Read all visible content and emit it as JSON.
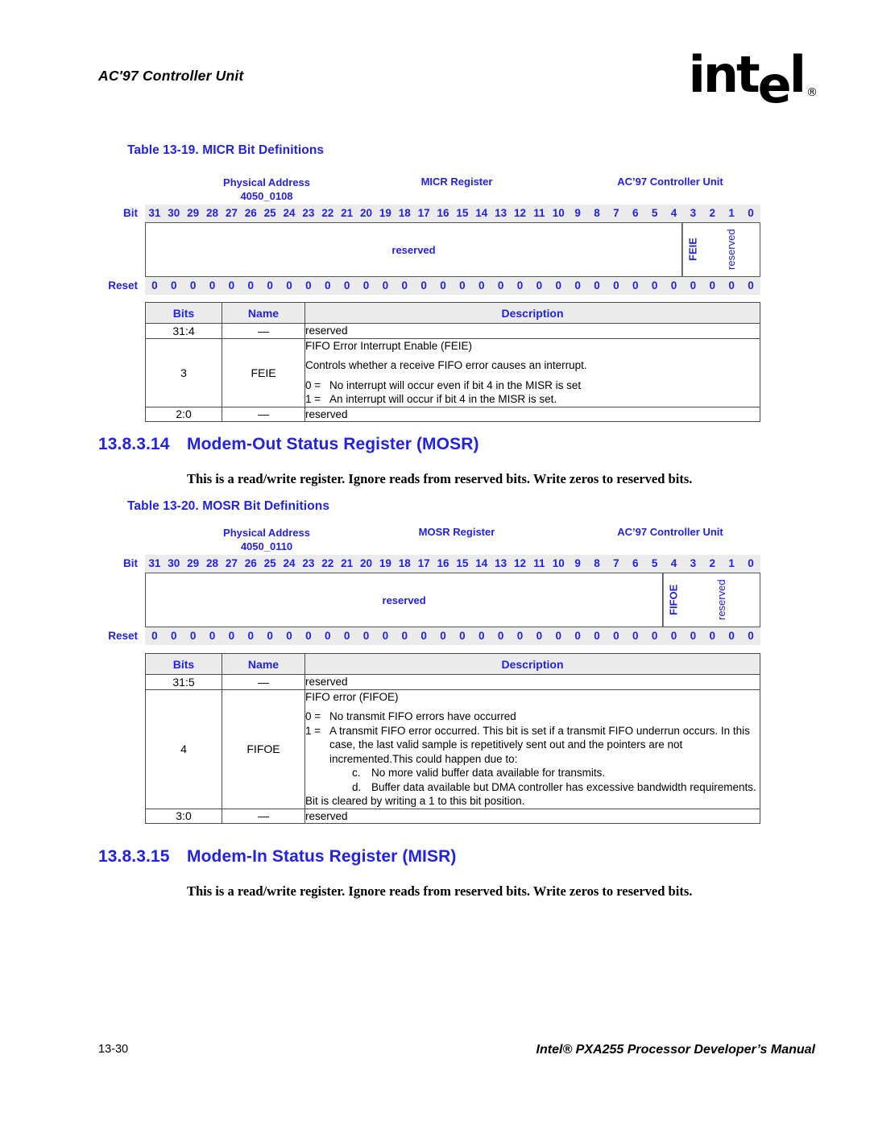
{
  "header": {
    "running_title": "AC'97 Controller Unit",
    "logo_text": "intel",
    "logo_registered": "®"
  },
  "footer": {
    "page_number": "13-30",
    "manual_title": "Intel® PXA255 Processor Developer’s Manual"
  },
  "colors": {
    "accent_blue": "#2222E0",
    "header_fill": "#ebebeb",
    "border": "#4a4a4a"
  },
  "bit_numbers": [
    "31",
    "30",
    "29",
    "28",
    "27",
    "26",
    "25",
    "24",
    "23",
    "22",
    "21",
    "20",
    "19",
    "18",
    "17",
    "16",
    "15",
    "14",
    "13",
    "12",
    "11",
    "10",
    "9",
    "8",
    "7",
    "6",
    "5",
    "4",
    "3",
    "2",
    "1",
    "0"
  ],
  "reset_values": [
    "0",
    "0",
    "0",
    "0",
    "0",
    "0",
    "0",
    "0",
    "0",
    "0",
    "0",
    "0",
    "0",
    "0",
    "0",
    "0",
    "0",
    "0",
    "0",
    "0",
    "0",
    "0",
    "0",
    "0",
    "0",
    "0",
    "0",
    "0",
    "0",
    "0",
    "0",
    "0"
  ],
  "labels": {
    "bit_row": "Bit",
    "reset_row": "Reset",
    "physical_address": "Physical Address",
    "col_bits": "Bits",
    "col_name": "Name",
    "col_description": "Description",
    "dash": "—"
  },
  "micr": {
    "caption": "Table 13-19. MICR Bit Definitions",
    "physical_address_value": "4050_0108",
    "register_name": "MICR Register",
    "unit_name": "AC’97 Controller Unit",
    "fields": [
      {
        "label": "reserved",
        "span": 28,
        "orientation": "horizontal",
        "bold": true
      },
      {
        "label": "FEIE",
        "span": 1,
        "orientation": "vertical",
        "bold": true
      },
      {
        "label": "reserved",
        "span": 3,
        "orientation": "vertical",
        "bold": false
      }
    ],
    "rows": [
      {
        "bits": "31:4",
        "name": "—",
        "lines": [
          {
            "kind": "plain",
            "text": "reserved"
          }
        ]
      },
      {
        "bits": "3",
        "name": "FEIE",
        "lines": [
          {
            "kind": "plain",
            "text": "FIFO Error Interrupt Enable (FEIE)"
          },
          {
            "kind": "plain_sp",
            "text": "Controls whether a receive FIFO error causes an interrupt."
          },
          {
            "kind": "eq_sp",
            "key": "0 =",
            "text": "No interrupt will occur even if bit 4 in the MISR is set"
          },
          {
            "kind": "eq",
            "key": "1 =",
            "text": "An interrupt will occur if bit 4 in the MISR is set."
          }
        ]
      },
      {
        "bits": "2:0",
        "name": "—",
        "lines": [
          {
            "kind": "plain",
            "text": "reserved"
          }
        ]
      }
    ]
  },
  "section_mosr": {
    "number": "13.8.3.14",
    "title": "Modem-Out Status Register (MOSR)",
    "paragraph": "This is a read/write register. Ignore reads from reserved bits. Write zeros to reserved bits."
  },
  "mosr": {
    "caption": "Table 13-20. MOSR Bit Definitions",
    "physical_address_value": "4050_0110",
    "register_name": "MOSR Register",
    "unit_name": "AC’97 Controller Unit",
    "fields": [
      {
        "label": "reserved",
        "span": 27,
        "orientation": "horizontal",
        "bold": true
      },
      {
        "label": "FIFOE",
        "span": 1,
        "orientation": "vertical",
        "bold": true
      },
      {
        "label": "reserved",
        "span": 4,
        "orientation": "vertical",
        "bold": false
      }
    ],
    "rows": [
      {
        "bits": "31:5",
        "name": "—",
        "lines": [
          {
            "kind": "plain",
            "text": "reserved"
          }
        ]
      },
      {
        "bits": "4",
        "name": "FIFOE",
        "lines": [
          {
            "kind": "plain",
            "text": "FIFO error (FIFOE)"
          },
          {
            "kind": "eq_sp",
            "key": "0 =",
            "text": "No transmit FIFO errors have occurred"
          },
          {
            "kind": "eq",
            "key": "1 =",
            "text": "A transmit FIFO error occurred. This bit is set if a transmit FIFO underrun occurs. In this case, the last valid sample is repetitively sent out and the pointers are not incremented.This could happen due to:"
          },
          {
            "kind": "sub",
            "key": "c.",
            "text": "No more valid buffer data available for transmits."
          },
          {
            "kind": "sub",
            "key": "d.",
            "text": "Buffer data available but DMA controller has excessive bandwidth requirements."
          },
          {
            "kind": "plain",
            "text": "Bit is cleared by writing a 1 to this bit position."
          }
        ]
      },
      {
        "bits": "3:0",
        "name": "—",
        "lines": [
          {
            "kind": "plain",
            "text": "reserved"
          }
        ]
      }
    ]
  },
  "section_misr": {
    "number": "13.8.3.15",
    "title": "Modem-In Status Register (MISR)",
    "paragraph": "This is a read/write register. Ignore reads from reserved bits. Write zeros to reserved bits."
  }
}
